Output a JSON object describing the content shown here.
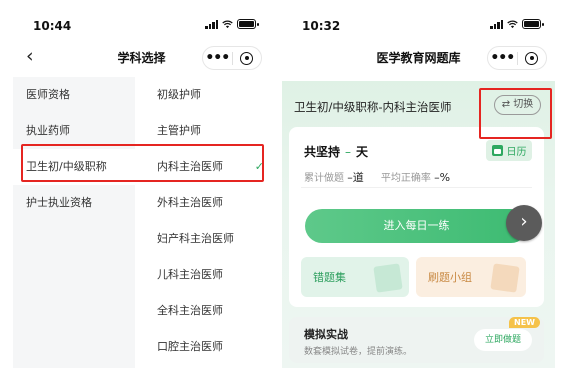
{
  "left": {
    "status": {
      "time": "10:44"
    },
    "nav": {
      "back": "‹",
      "title": "学科选择",
      "more": "•••"
    },
    "categories": [
      {
        "label": "医师资格",
        "active": false
      },
      {
        "label": "执业药师",
        "active": false
      },
      {
        "label": "卫生初/中级职称",
        "active": true
      },
      {
        "label": "护士执业资格",
        "active": false
      }
    ],
    "subjects": [
      {
        "label": "初级护师",
        "checked": false
      },
      {
        "label": "主管护师",
        "checked": false
      },
      {
        "label": "内科主治医师",
        "checked": true
      },
      {
        "label": "外科主治医师",
        "checked": false
      },
      {
        "label": "妇产科主治医师",
        "checked": false
      },
      {
        "label": "儿科主治医师",
        "checked": false
      },
      {
        "label": "全科主治医师",
        "checked": false
      },
      {
        "label": "口腔主治医师",
        "checked": false
      }
    ],
    "check_mark": "✓"
  },
  "right": {
    "status": {
      "time": "10:32"
    },
    "nav": {
      "title": "医学教育网题库",
      "more": "•••"
    },
    "subject": "卫生初/中级职称-内科主治医师",
    "switch_label": "⇄ 切换",
    "streak": {
      "prefix": "共坚持",
      "value": "–",
      "suffix": "天"
    },
    "calendar_label": "日历",
    "stats": {
      "done_label": "累计做题",
      "done_value": "–道",
      "accuracy_label": "平均正确率",
      "accuracy_value": "–%"
    },
    "practice_label": "进入每日一练",
    "arrow": "›",
    "wrong_label": "错题集",
    "group_label": "刷题小组",
    "mock": {
      "title": "模拟实战",
      "desc": "数套模拟试卷，提前演练。",
      "button": "立即做题",
      "badge": "NEW"
    }
  },
  "colors": {
    "accent": "#2ea860",
    "highlight": "#e52521",
    "tile_orange": "#c98a44"
  },
  "icons": [
    "back-arrow-icon",
    "more-icon",
    "close-circle-icon",
    "signal-icon",
    "wifi-icon",
    "battery-icon",
    "check-icon",
    "switch-icon",
    "calendar-icon",
    "chevron-right-icon"
  ]
}
